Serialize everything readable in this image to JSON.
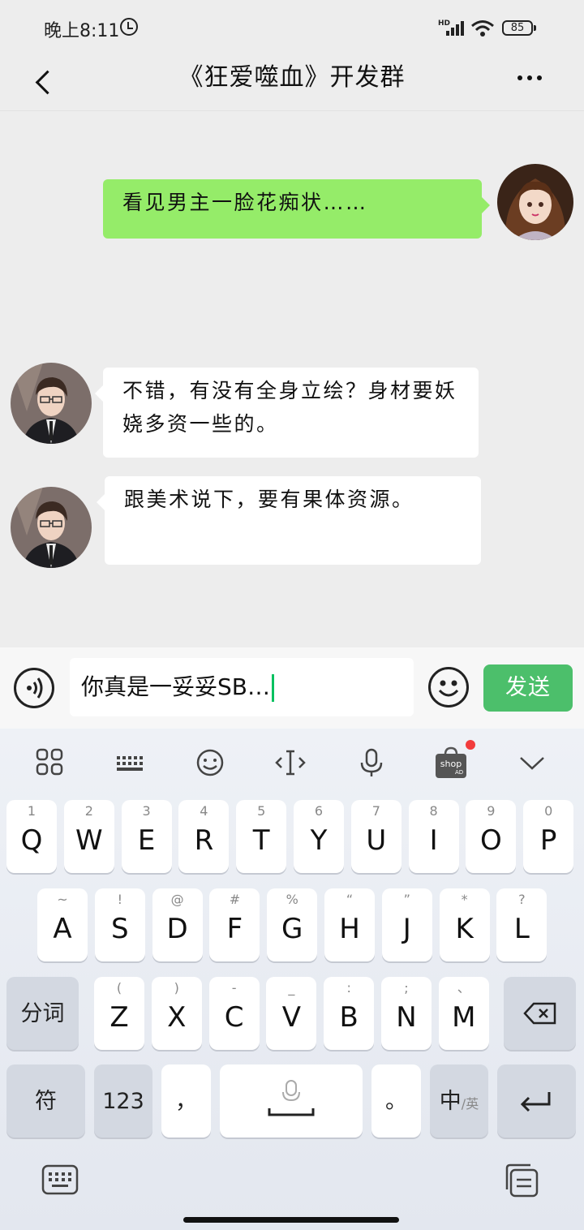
{
  "status_bar": {
    "time": "晚上8:11",
    "battery": "85",
    "network": "HD"
  },
  "header": {
    "title": "《狂爱噬血》开发群"
  },
  "messages": [
    {
      "side": "out",
      "text": "看见男主一脸花痴状……"
    },
    {
      "side": "in",
      "text": "不错，有没有全身立绘？身材要妖娆多资一些的。"
    },
    {
      "side": "in",
      "text": "跟美术说下，要有果体资源。"
    }
  ],
  "input": {
    "value": "你真是一妥妥SB…",
    "send_label": "发送"
  },
  "keyboard": {
    "row1": [
      {
        "main": "Q",
        "sub": "1"
      },
      {
        "main": "W",
        "sub": "2"
      },
      {
        "main": "E",
        "sub": "3"
      },
      {
        "main": "R",
        "sub": "4"
      },
      {
        "main": "T",
        "sub": "5"
      },
      {
        "main": "Y",
        "sub": "6"
      },
      {
        "main": "U",
        "sub": "7"
      },
      {
        "main": "I",
        "sub": "8"
      },
      {
        "main": "O",
        "sub": "9"
      },
      {
        "main": "P",
        "sub": "0"
      }
    ],
    "row2": [
      {
        "main": "A",
        "sub": "~"
      },
      {
        "main": "S",
        "sub": "!"
      },
      {
        "main": "D",
        "sub": "@"
      },
      {
        "main": "F",
        "sub": "#"
      },
      {
        "main": "G",
        "sub": "%"
      },
      {
        "main": "H",
        "sub": "“"
      },
      {
        "main": "J",
        "sub": "”"
      },
      {
        "main": "K",
        "sub": "*"
      },
      {
        "main": "L",
        "sub": "?"
      }
    ],
    "row3": [
      {
        "main": "Z",
        "sub": "("
      },
      {
        "main": "X",
        "sub": ")"
      },
      {
        "main": "C",
        "sub": "-"
      },
      {
        "main": "V",
        "sub": "_"
      },
      {
        "main": "B",
        "sub": ":"
      },
      {
        "main": "N",
        "sub": ";"
      },
      {
        "main": "M",
        "sub": "、"
      }
    ],
    "fenci_label": "分词",
    "fu_label": "符",
    "num_label": "123",
    "comma": "，",
    "period": "。",
    "lang_main": "中",
    "lang_sub": "/英",
    "shop_label": "shop",
    "shop_ad": "AD"
  }
}
